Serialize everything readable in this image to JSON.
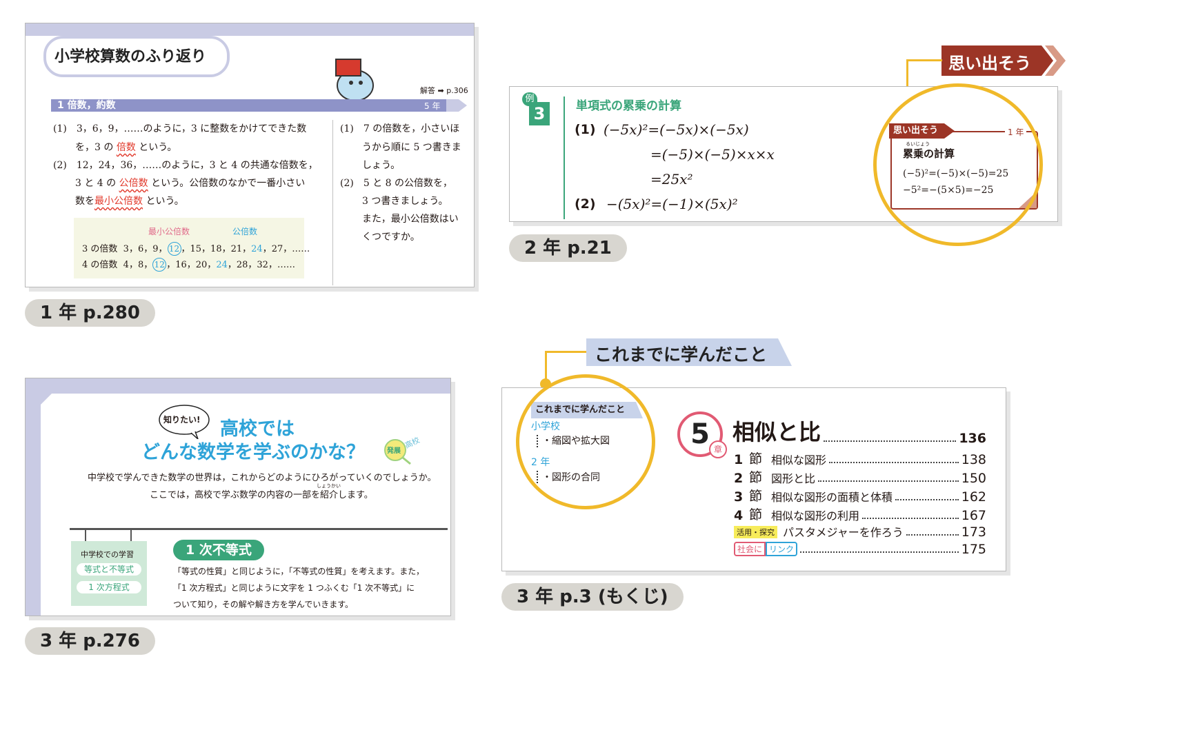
{
  "p1": {
    "caption": "1 年 p.280",
    "title": "小学校算数のふり返り",
    "answer_ref": "解答",
    "answer_page": "p.306",
    "section_label": "1 倍数，約数",
    "section_grade": "5 年",
    "l1_a": "(1)　3，6，9，……のように，3 に整数をかけてできた数",
    "l1_b1": "を，3 の",
    "l1_b2": "倍数",
    "l1_b3": "という。",
    "l2_a": "(2)　12，24，36，……のように，3 と 4 の共通な倍数を，",
    "l2_b1": "3 と 4 の",
    "l2_b2": "公倍数",
    "l2_b3": "という。公倍数のなかで一番小さい",
    "l2_c1": "数を",
    "l2_c2": "最小公倍数",
    "l2_c3": "という。",
    "box_lcm": "最小公倍数",
    "box_cm": "公倍数",
    "m3_label": "3 の倍数",
    "m3_1": "3，6，9，",
    "m3_12": "12",
    "m3_2": "，15，18，21，",
    "m3_24": "24",
    "m3_3": "，27，……",
    "m4_label": "4 の倍数",
    "m4_1": "4，8，",
    "m4_12": "12",
    "m4_2": "，16，20，",
    "m4_24": "24",
    "m4_3": "，28，32，……",
    "q1_a": "(1)　7 の倍数を，小さいほ",
    "q1_b": "うから順に 5 つ書きま",
    "q1_c": "しょう。",
    "q2_a": "(2)　5 と 8 の公倍数を，",
    "q2_b": "3 つ書きましょう。",
    "q2_c": "また，最小公倍数はい",
    "q2_d": "くつですか。"
  },
  "p2": {
    "caption": "2 年 p.21",
    "banner": "思い出そう",
    "ex_label": "例",
    "ex_num": "3",
    "heading": "単項式の累乗の計算",
    "eq1_num": "(1)",
    "eq1": "(−5x)²=(−5x)×(−5x)",
    "eq2": "=(−5)×(−5)×x×x",
    "eq3": "=25x²",
    "eq4_num": "(2)",
    "eq4": "−(5x)²=(−1)×(5x)²",
    "side_tag": "思い出そう",
    "side_grade": "1 年",
    "side_ruby": "るいじょう",
    "side_title": "累乗の計算",
    "side_eq1": "(−5)²=(−5)×(−5)=25",
    "side_eq2": "−5²=−(5×5)=−25"
  },
  "p3": {
    "caption": "3 年 p.276",
    "bubble": "知りたい!",
    "title1": "高校では",
    "title2": "どんな数学を学ぶのかな？",
    "badge1": "発展",
    "badge2": "高校",
    "intro1": "中学校で学んできた数学の世界は，これからどのようにひろがっていくのでしょうか。",
    "intro2": "ここでは，高校で学ぶ数学の内容の一部を紹介します。",
    "ruby": "しょうかい",
    "side_head": "中学校での学習",
    "side_item1": "等式と不等式",
    "side_item2": "1 次方程式",
    "topic": "1 次不等式",
    "body1": "「等式の性質」と同じように，「不等式の性質」を考えます。また，",
    "body2": "「1 次方程式」と同じように文字を 1 つふくむ「1 次不等式」に",
    "body3": "ついて知り，その解や解き方を学んでいきます。"
  },
  "p4": {
    "caption": "3 年 p.3 (もくじ)",
    "banner": "これまでに学んだこと",
    "side_head": "これまでに学んだこと",
    "g1": "小学校",
    "g1_item": "・縮図や拡大図",
    "g2": "2 年",
    "g2_item": "・図形の合同",
    "chapter_num": "5",
    "chapter_suffix": "章",
    "chapter_title": "相似と比",
    "chapter_page": "136",
    "rows": [
      {
        "num": "1",
        "unit": "節",
        "title": "相似な図形",
        "page": "138"
      },
      {
        "num": "2",
        "unit": "節",
        "title": "図形と比",
        "page": "150"
      },
      {
        "num": "3",
        "unit": "節",
        "title": "相似な図形の面積と体積",
        "page": "162"
      },
      {
        "num": "4",
        "unit": "節",
        "title": "相似な図形の利用",
        "page": "167"
      }
    ],
    "tag1": "活用・探究",
    "row5_title": "パスタメジャーを作ろう",
    "row5_page": "173",
    "tag2a": "社会に",
    "tag2b": "リンク",
    "row6_page": "175"
  },
  "colors": {
    "accent_purple": "#8e93c8",
    "accent_green": "#3aa57a",
    "accent_red": "#e1382a",
    "accent_blue": "#2ea3d8",
    "accent_yellow": "#f0b92a",
    "banner_dark_red": "#9c3526",
    "chapter_pink": "#e15a73"
  }
}
